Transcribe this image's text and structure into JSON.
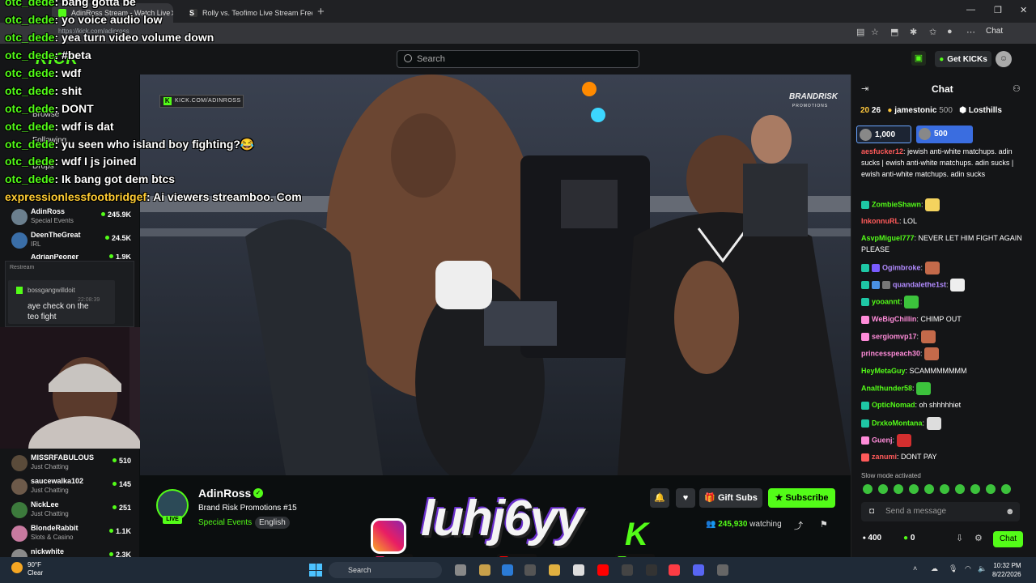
{
  "browser": {
    "tabs": [
      {
        "label": "AdinRoss Stream - Watch Live",
        "icon_color": "#53fc18"
      },
      {
        "label": "Rolly vs. Teofimo Live Stream Free",
        "icon_color": "#ffffff"
      }
    ],
    "url": "https://kick.com/adinross",
    "chat_button": "Chat",
    "new_tab": "+",
    "window_controls": [
      "—",
      "❐",
      "✕"
    ]
  },
  "header": {
    "logo": "KICK",
    "search_placeholder": "Search",
    "get_kicks": "Get KICKs"
  },
  "sidebar": {
    "nav": [
      "Browse",
      "Following",
      "Drops"
    ],
    "channels": [
      {
        "name": "AdinRoss",
        "category": "Special Events",
        "viewers": "245.9K",
        "color": "#6b7f8e"
      },
      {
        "name": "DeenTheGreat",
        "category": "IRL",
        "viewers": "24.5K",
        "color": "#3a6ea8"
      },
      {
        "name": "AdrianPeoner",
        "category": "",
        "viewers": "1.9K",
        "color": "#aa6a4a"
      }
    ],
    "bottom_channels": [
      {
        "name": "MISSRFABULOUS",
        "category": "Just Chatting",
        "viewers": "510",
        "color": "#5a4b3a"
      },
      {
        "name": "saucewalka102",
        "category": "Just Chatting",
        "viewers": "145",
        "color": "#6d5a4a"
      },
      {
        "name": "NickLee",
        "category": "Just Chatting",
        "viewers": "251",
        "color": "#3c7a3c"
      },
      {
        "name": "BlondeRabbit",
        "category": "Slots & Casino",
        "viewers": "1.1K",
        "color": "#c87aa0"
      },
      {
        "name": "nickwhite",
        "category": "",
        "viewers": "2.3K",
        "color": "#8a8a8a"
      }
    ]
  },
  "restream": {
    "label": "Restream",
    "user": "bossgangwilldoit",
    "time": "22:08:39",
    "text": "aye check on the teo fight"
  },
  "overlay_chat": [
    {
      "user": "otc_dede",
      "text": "bang gotta be"
    },
    {
      "user": "otc_dede",
      "text": "yo voice audio low"
    },
    {
      "user": "otc_dede",
      "text": "yea turn video volume down"
    },
    {
      "user": "otc_dede",
      "text": "#beta"
    },
    {
      "user": "otc_dede",
      "text": "wdf"
    },
    {
      "user": "otc_dede",
      "text": "shit"
    },
    {
      "user": "otc_dede",
      "text": "DONT"
    },
    {
      "user": "otc_dede",
      "text": "wdf is dat"
    },
    {
      "user": "otc_dede",
      "text": "yu seen who island boy fighting?😂"
    },
    {
      "user": "otc_dede",
      "text": "wdf I js joined"
    },
    {
      "user": "otc_dede",
      "text": "Ik bang got dem btcs"
    },
    {
      "user": "expressionlessfootbridgef",
      "text": "Ai viewers streamboo. Com"
    }
  ],
  "video": {
    "watermark": "KICK.COM/ADINROSS",
    "brand": "BRANDRISK",
    "brand_sub": "PROMOTIONS"
  },
  "channel": {
    "name": "AdinRoss",
    "live": "LIVE",
    "title": "Brand Risk Promotions #15",
    "category": "Special Events",
    "language": "English",
    "gift_subs": "Gift Subs",
    "subscribe": "Subscribe",
    "watching_count": "245,930",
    "watching_label": "watching"
  },
  "chat": {
    "title": "Chat",
    "leaderboard": [
      {
        "rank_value": "20",
        "count": "26"
      },
      {
        "name": "jamestonic",
        "count": "500"
      },
      {
        "name": "Losthills",
        "count": ""
      }
    ],
    "gifts": [
      "1,000",
      "500"
    ],
    "messages": [
      {
        "user": "aesfucker12",
        "color": "#ff5a5a",
        "text": "jewish anti-white matchups. adin sucks | ewish anti-white matchups. adin sucks | ewish anti-white matchups. adin sucks"
      },
      {
        "user": "ZombieShawn",
        "color": "#53fc18",
        "text": ""
      },
      {
        "user": "InkonnuRL",
        "color": "#ff5a5a",
        "text": "LOL"
      },
      {
        "user": "AsvpMiguel777",
        "color": "#53fc18",
        "text": "NEVER LET HIM FIGHT AGAIN PLEASE"
      },
      {
        "user": "Ogimbroke",
        "color": "#b28bff",
        "text": ""
      },
      {
        "user": "quandalethe1st",
        "color": "#b28bff",
        "text": ""
      },
      {
        "user": "yooannt",
        "color": "#53fc18",
        "text": ""
      },
      {
        "user": "WeBigChillin",
        "color": "#ff8cd9",
        "text": "CHIMP OUT"
      },
      {
        "user": "sergiomvp17",
        "color": "#ff8cd9",
        "text": ""
      },
      {
        "user": "princesspeach30",
        "color": "#ff8cd9",
        "text": ""
      },
      {
        "user": "HeyMetaGuy",
        "color": "#53fc18",
        "text": "SCAMMMMMMM"
      },
      {
        "user": "Analthunder58",
        "color": "#53fc18",
        "text": ""
      },
      {
        "user": "OpticNomad",
        "color": "#53fc18",
        "text": "oh shhhhhiet"
      },
      {
        "user": "DrxkoMontana",
        "color": "#53fc18",
        "text": ""
      },
      {
        "user": "Guenj",
        "color": "#ff8cd9",
        "text": ""
      },
      {
        "user": "zanumi",
        "color": "#ff5a5a",
        "text": "DONT PAY"
      }
    ],
    "slow_mode": "Slow mode activated",
    "input_placeholder": "Send a message",
    "points": "400",
    "kicks": "0",
    "send_label": "Chat"
  },
  "brand_overlay": {
    "text": "luhj6yy",
    "k": "K",
    "handles": [
      "luhj6yy",
      "luhj6yy",
      "luhj6yy"
    ]
  },
  "taskbar": {
    "temp": "90°F",
    "weather": "Clear",
    "search": "Search",
    "time": "10:32 PM",
    "date": "8/22/2026"
  }
}
